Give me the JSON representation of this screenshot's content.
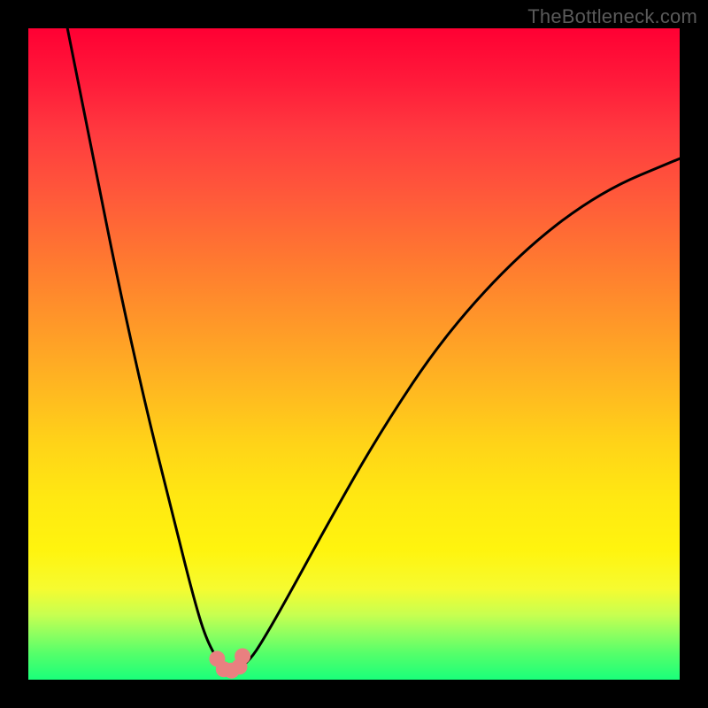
{
  "watermark": "TheBottleneck.com",
  "chart_data": {
    "type": "line",
    "title": "",
    "xlabel": "",
    "ylabel": "",
    "xlim": [
      0,
      100
    ],
    "ylim": [
      0,
      100
    ],
    "series": [
      {
        "name": "curve",
        "x": [
          6,
          10,
          14,
          18,
          22,
          25,
          27,
          29,
          30.5,
          32,
          34,
          36,
          40,
          46,
          54,
          64,
          76,
          88,
          100
        ],
        "y": [
          100,
          80,
          60,
          42,
          26,
          14,
          7,
          3,
          1.5,
          1.5,
          3,
          6,
          13,
          24,
          38,
          53,
          66,
          75,
          80
        ]
      }
    ],
    "valley_markers": {
      "x": [
        29.0,
        30.0,
        31.2,
        32.4,
        32.9
      ],
      "y": [
        3.2,
        1.6,
        1.4,
        2.0,
        3.6
      ]
    },
    "gradient_stops": [
      {
        "pos": 0.0,
        "color": "#ff0033"
      },
      {
        "pos": 0.5,
        "color": "#ffba20"
      },
      {
        "pos": 0.8,
        "color": "#fff40e"
      },
      {
        "pos": 1.0,
        "color": "#1aff7a"
      }
    ]
  }
}
